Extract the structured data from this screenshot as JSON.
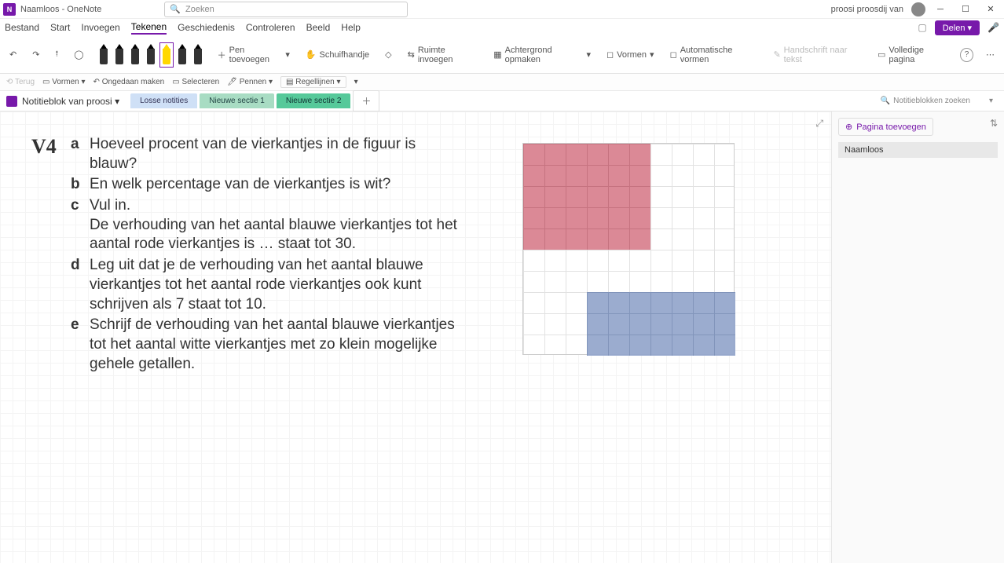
{
  "titlebar": {
    "app_icon_letter": "N",
    "title": "Naamloos - OneNote",
    "search_placeholder": "Zoeken",
    "user_name": "proosi proosdij van"
  },
  "menu": {
    "items": [
      "Bestand",
      "Start",
      "Invoegen",
      "Tekenen",
      "Geschiedenis",
      "Controleren",
      "Beeld",
      "Help"
    ],
    "active_index": 3
  },
  "ribbon": {
    "pen_colors": [
      "#000000",
      "#e81123",
      "#3b6fc4",
      "#00b050",
      "#ffd800",
      "#7030a0",
      "#c06090"
    ],
    "selected_pen": 4,
    "add_pen": "Pen toevoegen",
    "lasso": "Schuifhandje",
    "eraser": "",
    "ruler": "Ruimte invoegen",
    "background": "Achtergrond opmaken",
    "shapes": "Vormen",
    "auto_shapes": "Automatische vormen",
    "ink_to_text": "Handschrift naar tekst",
    "full_page": "Volledige pagina",
    "share": "Delen"
  },
  "qbar": {
    "cancel": "Terug",
    "shapes": "Vormen",
    "undo": "Ongedaan maken",
    "select": "Selecteren",
    "draw": "Pennen",
    "ruled": "Regellijnen"
  },
  "notebook": {
    "title": "Notitieblok van proosi",
    "tabs": [
      "Losse notities",
      "Nieuwe sectie 1",
      "Nieuwe sectie 2"
    ],
    "search_placeholder": "Notitieblokken zoeken"
  },
  "sidepanel": {
    "add_page": "Pagina toevoegen",
    "page_title": "Naamloos"
  },
  "content": {
    "qnum": "V4",
    "items": [
      {
        "letter": "a",
        "text": "Hoeveel procent van de vierkantjes in de figuur is blauw?"
      },
      {
        "letter": "b",
        "text": "En welk percentage van de vierkantjes is wit?"
      },
      {
        "letter": "c",
        "text": "Vul in.\nDe verhouding van het aantal blauwe vierkantjes tot het aantal rode vierkantjes is … staat tot 30."
      },
      {
        "letter": "d",
        "text": "Leg uit dat je de verhouding van het aantal blauwe vierkantjes tot het aantal rode vierkantjes ook kunt schrijven als 7 staat tot 10."
      },
      {
        "letter": "e",
        "text": "Schrijf de verhouding van het aantal blauwe vierkantjes tot het aantal witte vierkantjes met zo klein mogelijke gehele getallen."
      }
    ]
  }
}
